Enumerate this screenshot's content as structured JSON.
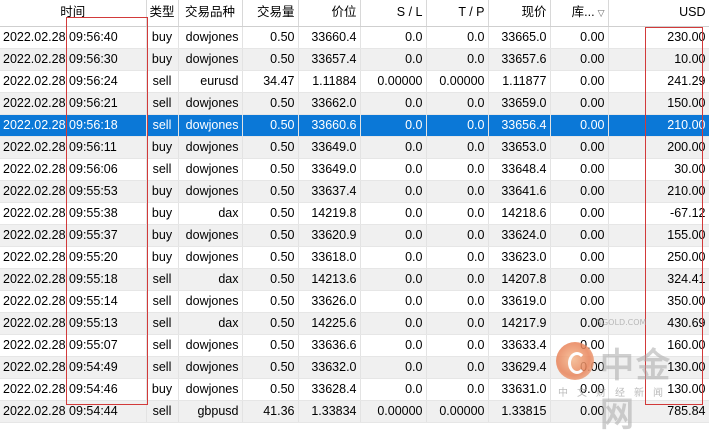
{
  "colors": {
    "selected_row": "#0b78d7",
    "annotation": "#d23a3a"
  },
  "columns": {
    "time": "时间",
    "type": "类型",
    "symbol": "交易品种",
    "volume": "交易量",
    "price": "价位",
    "sl": "S / L",
    "tp": "T / P",
    "current": "现价",
    "swap": "库...",
    "profit": "USD"
  },
  "sort_icon": "sort-down-icon",
  "rows": [
    {
      "date": "2022.02.28",
      "time": "09:56:40",
      "type": "buy",
      "symbol": "dowjones",
      "volume": "0.50",
      "price": "33660.4",
      "sl": "0.0",
      "tp": "0.0",
      "current": "33665.0",
      "swap": "0.00",
      "profit": "230.00"
    },
    {
      "date": "2022.02.28",
      "time": "09:56:30",
      "type": "buy",
      "symbol": "dowjones",
      "volume": "0.50",
      "price": "33657.4",
      "sl": "0.0",
      "tp": "0.0",
      "current": "33657.6",
      "swap": "0.00",
      "profit": "10.00"
    },
    {
      "date": "2022.02.28",
      "time": "09:56:24",
      "type": "sell",
      "symbol": "eurusd",
      "volume": "34.47",
      "price": "1.11884",
      "sl": "0.00000",
      "tp": "0.00000",
      "current": "1.11877",
      "swap": "0.00",
      "profit": "241.29"
    },
    {
      "date": "2022.02.28",
      "time": "09:56:21",
      "type": "sell",
      "symbol": "dowjones",
      "volume": "0.50",
      "price": "33662.0",
      "sl": "0.0",
      "tp": "0.0",
      "current": "33659.0",
      "swap": "0.00",
      "profit": "150.00"
    },
    {
      "date": "2022.02.28",
      "time": "09:56:18",
      "type": "sell",
      "symbol": "dowjones",
      "volume": "0.50",
      "price": "33660.6",
      "sl": "0.0",
      "tp": "0.0",
      "current": "33656.4",
      "swap": "0.00",
      "profit": "210.00",
      "selected": true
    },
    {
      "date": "2022.02.28",
      "time": "09:56:11",
      "type": "buy",
      "symbol": "dowjones",
      "volume": "0.50",
      "price": "33649.0",
      "sl": "0.0",
      "tp": "0.0",
      "current": "33653.0",
      "swap": "0.00",
      "profit": "200.00"
    },
    {
      "date": "2022.02.28",
      "time": "09:56:06",
      "type": "sell",
      "symbol": "dowjones",
      "volume": "0.50",
      "price": "33649.0",
      "sl": "0.0",
      "tp": "0.0",
      "current": "33648.4",
      "swap": "0.00",
      "profit": "30.00"
    },
    {
      "date": "2022.02.28",
      "time": "09:55:53",
      "type": "buy",
      "symbol": "dowjones",
      "volume": "0.50",
      "price": "33637.4",
      "sl": "0.0",
      "tp": "0.0",
      "current": "33641.6",
      "swap": "0.00",
      "profit": "210.00"
    },
    {
      "date": "2022.02.28",
      "time": "09:55:38",
      "type": "buy",
      "symbol": "dax",
      "volume": "0.50",
      "price": "14219.8",
      "sl": "0.0",
      "tp": "0.0",
      "current": "14218.6",
      "swap": "0.00",
      "profit": "-67.12"
    },
    {
      "date": "2022.02.28",
      "time": "09:55:37",
      "type": "buy",
      "symbol": "dowjones",
      "volume": "0.50",
      "price": "33620.9",
      "sl": "0.0",
      "tp": "0.0",
      "current": "33624.0",
      "swap": "0.00",
      "profit": "155.00"
    },
    {
      "date": "2022.02.28",
      "time": "09:55:20",
      "type": "buy",
      "symbol": "dowjones",
      "volume": "0.50",
      "price": "33618.0",
      "sl": "0.0",
      "tp": "0.0",
      "current": "33623.0",
      "swap": "0.00",
      "profit": "250.00"
    },
    {
      "date": "2022.02.28",
      "time": "09:55:18",
      "type": "sell",
      "symbol": "dax",
      "volume": "0.50",
      "price": "14213.6",
      "sl": "0.0",
      "tp": "0.0",
      "current": "14207.8",
      "swap": "0.00",
      "profit": "324.41"
    },
    {
      "date": "2022.02.28",
      "time": "09:55:14",
      "type": "sell",
      "symbol": "dowjones",
      "volume": "0.50",
      "price": "33626.0",
      "sl": "0.0",
      "tp": "0.0",
      "current": "33619.0",
      "swap": "0.00",
      "profit": "350.00"
    },
    {
      "date": "2022.02.28",
      "time": "09:55:13",
      "type": "sell",
      "symbol": "dax",
      "volume": "0.50",
      "price": "14225.6",
      "sl": "0.0",
      "tp": "0.0",
      "current": "14217.9",
      "swap": "0.00",
      "profit": "430.69"
    },
    {
      "date": "2022.02.28",
      "time": "09:55:07",
      "type": "sell",
      "symbol": "dowjones",
      "volume": "0.50",
      "price": "33636.6",
      "sl": "0.0",
      "tp": "0.0",
      "current": "33633.4",
      "swap": "0.00",
      "profit": "160.00"
    },
    {
      "date": "2022.02.28",
      "time": "09:54:49",
      "type": "sell",
      "symbol": "dowjones",
      "volume": "0.50",
      "price": "33632.0",
      "sl": "0.0",
      "tp": "0.0",
      "current": "33629.4",
      "swap": "0.00",
      "profit": "130.00"
    },
    {
      "date": "2022.02.28",
      "time": "09:54:46",
      "type": "buy",
      "symbol": "dowjones",
      "volume": "0.50",
      "price": "33628.4",
      "sl": "0.0",
      "tp": "0.0",
      "current": "33631.0",
      "swap": "0.00",
      "profit": "130.00"
    },
    {
      "date": "2022.02.28",
      "time": "09:54:44",
      "type": "sell",
      "symbol": "gbpusd",
      "volume": "41.36",
      "price": "1.33834",
      "sl": "0.00000",
      "tp": "0.00000",
      "current": "1.33815",
      "swap": "0.00",
      "profit": "785.84"
    }
  ],
  "watermark": {
    "text": "中金网",
    "subtext": "中文财经新闻",
    "url": "NGOLD.COM",
    "icon": "zhongjin-logo-icon"
  }
}
